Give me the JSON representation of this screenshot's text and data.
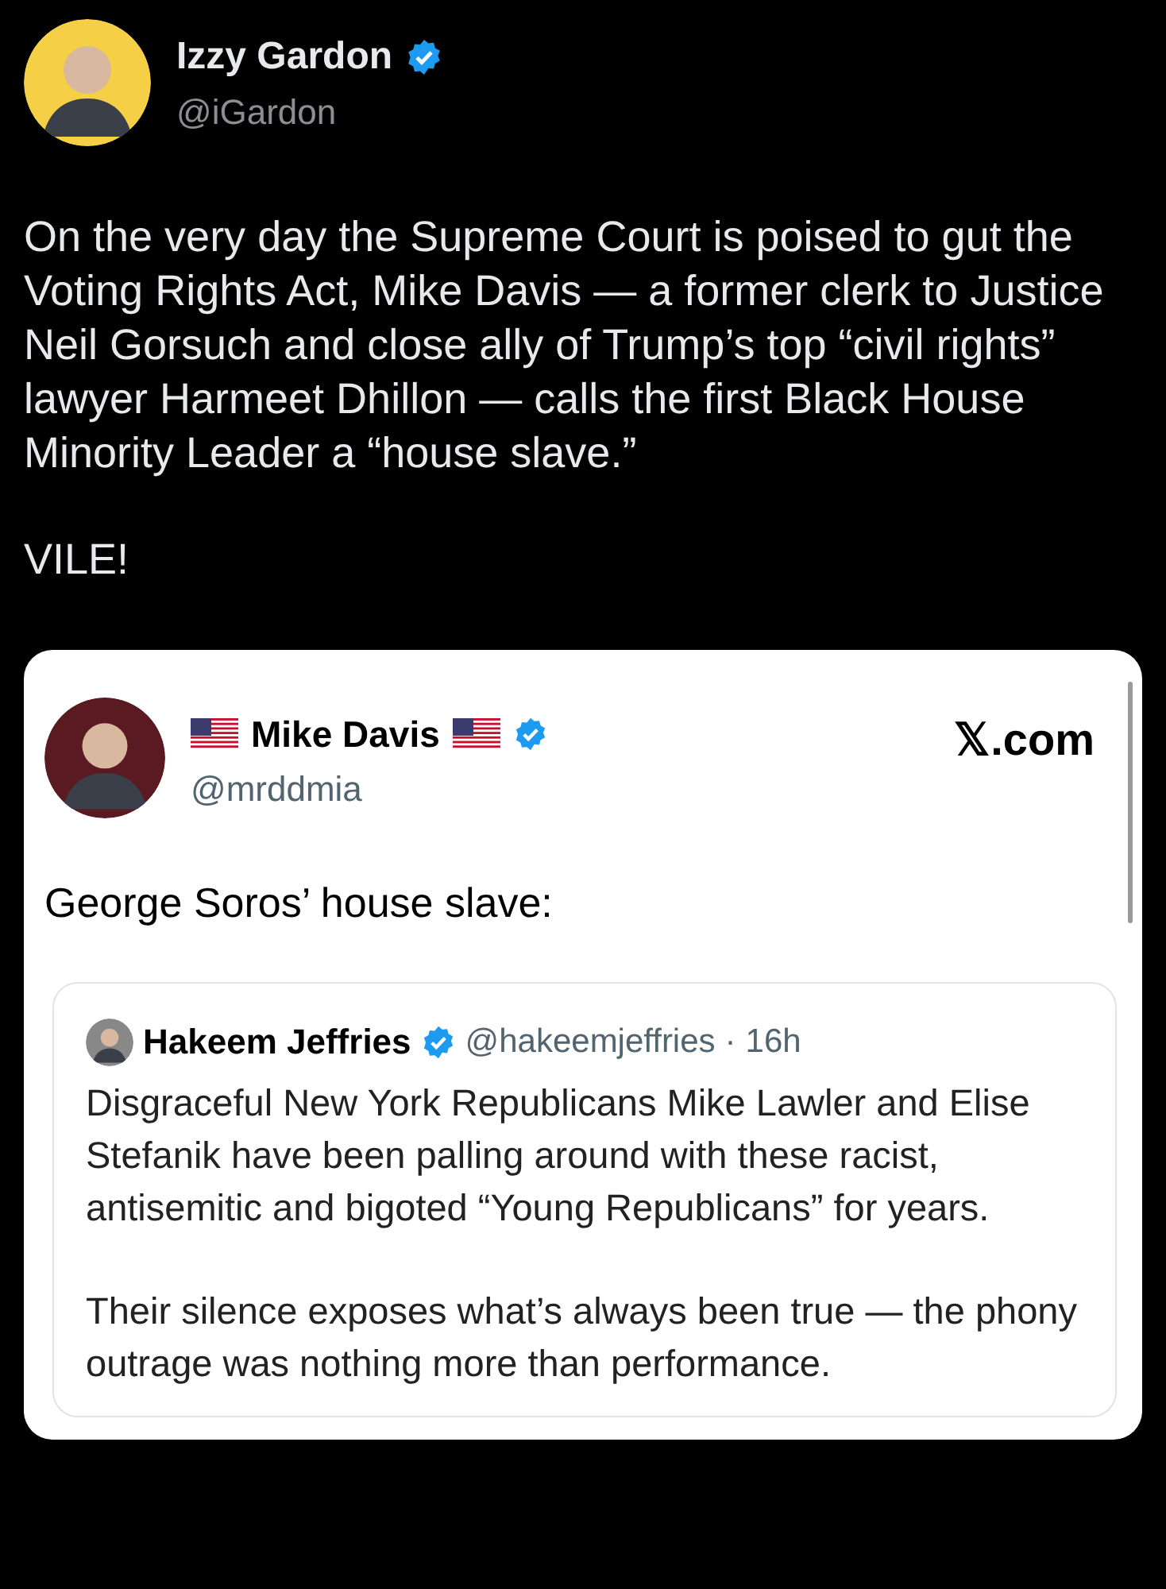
{
  "author": {
    "name": "Izzy Gardon",
    "verified": true,
    "handle": "@iGardon"
  },
  "paragraphs": [
    "On the very day the Supreme Court is poised to gut the Voting Rights Act, Mike Davis — a former clerk to Justice Neil Gorsuch and close ally of Trump’s top “civil rights” lawyer Harmeet Dhillon — calls the first Black House Minority Leader a “house slave.”",
    "VILE!"
  ],
  "screenshot": {
    "author": {
      "name": "Mike Davis",
      "verified": true,
      "handle": "@mrddmia",
      "flags": true
    },
    "site": "𝕏.com",
    "text": "George Soros’ house slave:",
    "quote": {
      "name": "Hakeem Jeffries",
      "verified": true,
      "handle": "@hakeemjeffries",
      "separator": "·",
      "time": "16h",
      "paragraphs": [
        "Disgraceful New York Republicans Mike Lawler and Elise Stefanik have been palling around with these racist, antisemitic and bigoted “Young Republicans” for years.",
        "Their silence exposes what’s always been true — the phony outrage was nothing more than performance."
      ]
    }
  }
}
